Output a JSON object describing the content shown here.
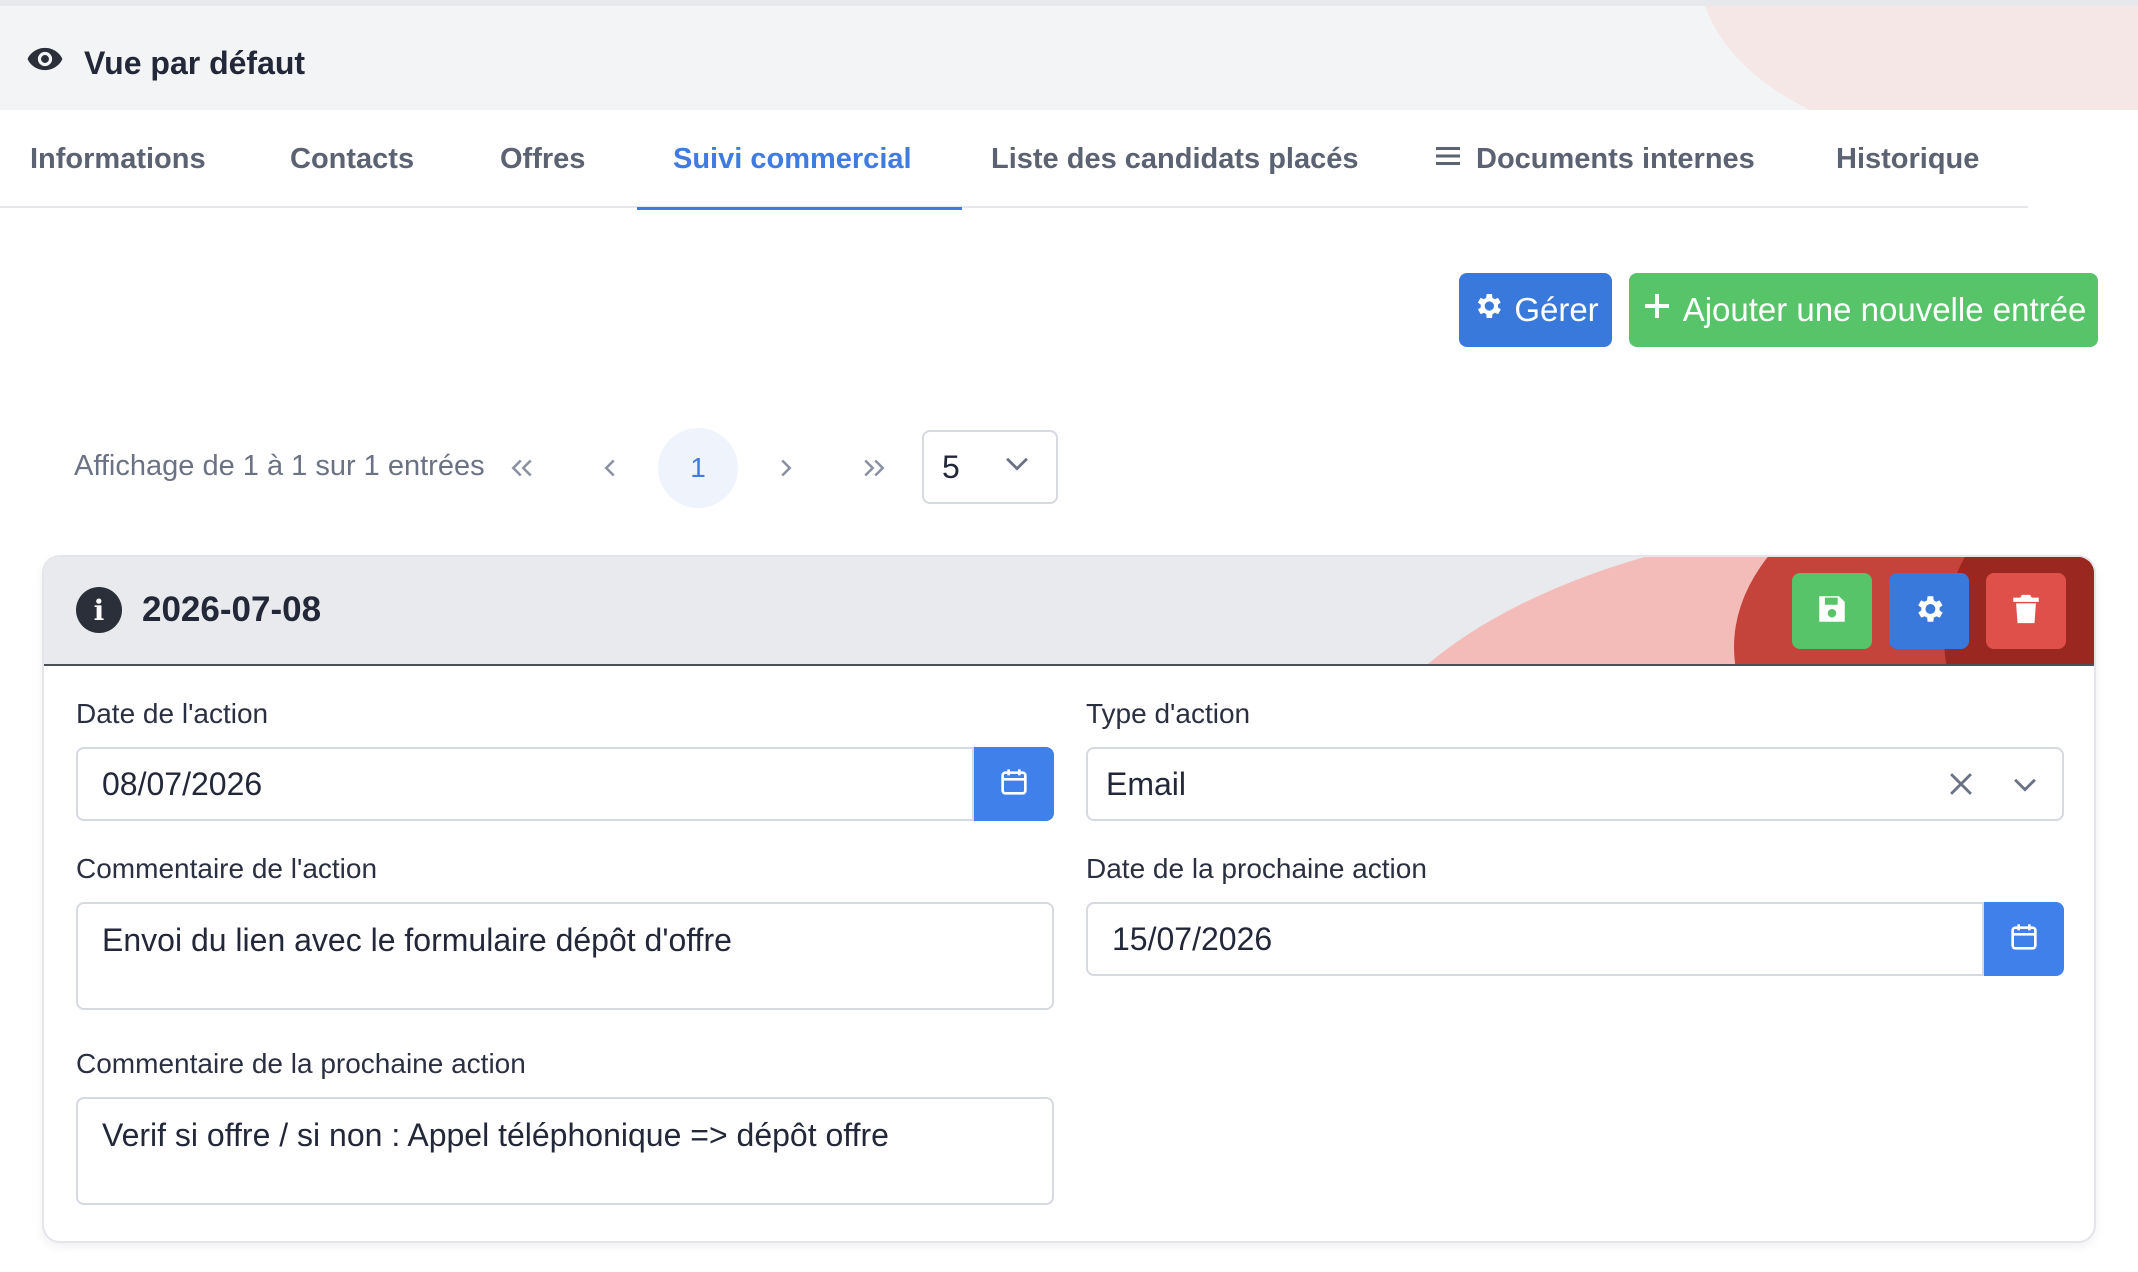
{
  "header": {
    "view_title": "Vue par défaut"
  },
  "tabs": [
    {
      "label": "Informations"
    },
    {
      "label": "Contacts"
    },
    {
      "label": "Offres"
    },
    {
      "label": "Suivi commercial",
      "active": true
    },
    {
      "label": "Liste des candidats placés"
    },
    {
      "label": "Documents internes",
      "icon": "list-icon"
    },
    {
      "label": "Historique"
    }
  ],
  "actions": {
    "manage_label": "Gérer",
    "add_label": "Ajouter une nouvelle entrée"
  },
  "pagination": {
    "info": "Affichage de 1 à 1 sur 1 entrées",
    "current_page": "1",
    "page_size": "5"
  },
  "entry": {
    "title": "2026-07-08",
    "fields": {
      "action_date_label": "Date de l'action",
      "action_date_value": "08/07/2026",
      "action_type_label": "Type d'action",
      "action_type_value": "Email",
      "action_comment_label": "Commentaire de l'action",
      "action_comment_value": "Envoi du lien avec le formulaire dépôt d'offre",
      "next_action_date_label": "Date de la prochaine action",
      "next_action_date_value": "15/07/2026",
      "next_action_comment_label": "Commentaire de la prochaine action",
      "next_action_comment_value": "Verif si offre / si non : Appel téléphonique => dépôt offre"
    }
  },
  "colors": {
    "primary": "#3979dc",
    "success": "#58c46a",
    "danger": "#e0504a",
    "tab_active": "#3f7be0"
  }
}
